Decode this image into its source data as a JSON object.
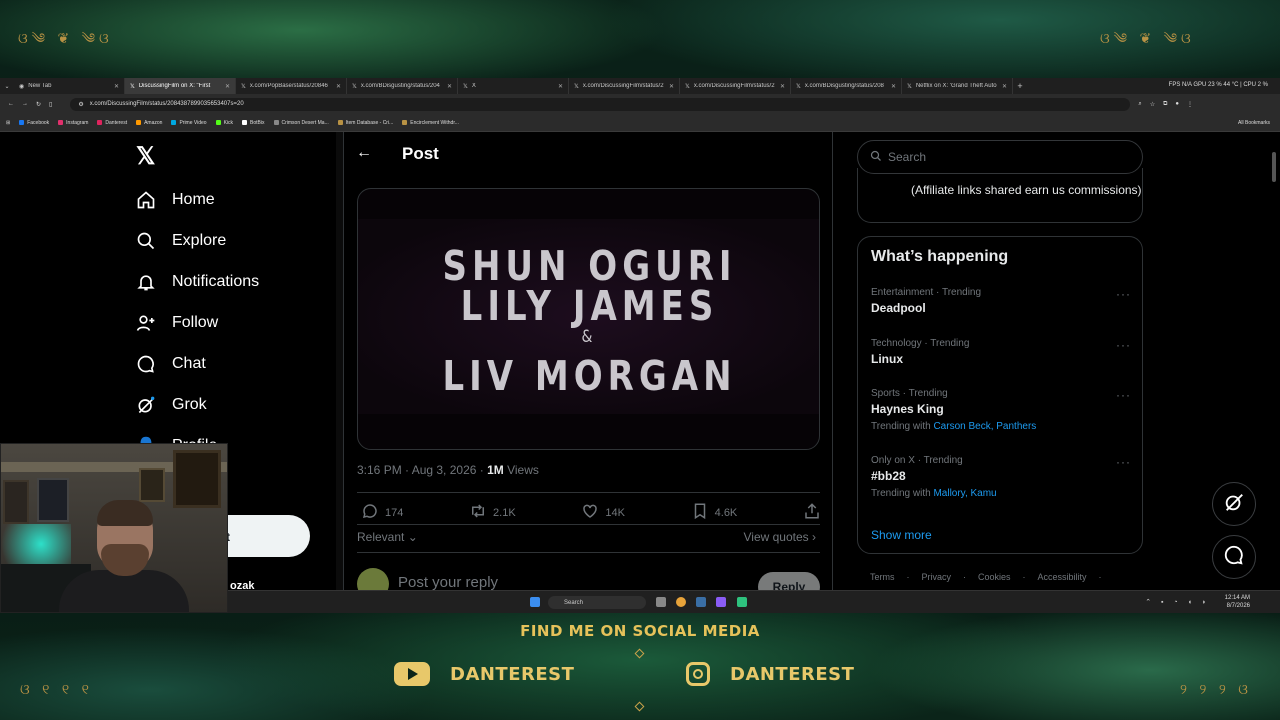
{
  "browser": {
    "tabs": [
      {
        "label": "New Tab",
        "active": false
      },
      {
        "label": "DiscussingFilm on X: \"First",
        "active": true
      },
      {
        "label": "x.com/PopBase/status/20846",
        "active": false
      },
      {
        "label": "x.com/BDisgusting/status/204",
        "active": false
      },
      {
        "label": "X",
        "active": false
      },
      {
        "label": "x.com/DiscussingFilm/status/2",
        "active": false
      },
      {
        "label": "x.com/DiscussingFilm/status/2",
        "active": false
      },
      {
        "label": "x.com/BDisgusting/status/208",
        "active": false
      },
      {
        "label": "Netflix on X: 'Grand Theft Auto",
        "active": false
      }
    ],
    "tab_close": "✕",
    "new_tab": "+",
    "sysinfo": "FPS  N/A   GPU  23 %  44 °C  |  CPU  2 %",
    "url": "x.com/DiscussingFilm/status/2084387899035653407s=20",
    "bookmarks": [
      {
        "label": "Facebook",
        "color": "#1877f2"
      },
      {
        "label": "Instagram",
        "color": "#e1306c"
      },
      {
        "label": "Danterest",
        "color": "#e0245e"
      },
      {
        "label": "Amazon",
        "color": "#ff9900"
      },
      {
        "label": "Prime Video",
        "color": "#00a8e1"
      },
      {
        "label": "Kick",
        "color": "#53fc18"
      },
      {
        "label": "BotBix",
        "color": "#ffffff"
      },
      {
        "label": "Crimson Desert Ma...",
        "color": "#888888"
      },
      {
        "label": "Item Database - Cri...",
        "color": "#b89244"
      },
      {
        "label": "Encirclement Withdr...",
        "color": "#b89244"
      }
    ],
    "all_bookmarks": "All Bookmarks"
  },
  "nav": {
    "logo": "𝕏",
    "items": [
      {
        "label": "Home"
      },
      {
        "label": "Explore"
      },
      {
        "label": "Notifications"
      },
      {
        "label": "Follow"
      },
      {
        "label": "Chat"
      },
      {
        "label": "Grok"
      },
      {
        "label": "Profile"
      }
    ],
    "post_label": "t",
    "user_fragment": "ozak"
  },
  "post": {
    "header": "Post",
    "back": "←",
    "cast_lines": [
      "SHUN OGURI",
      "LILY JAMES",
      "&",
      "LIV MORGAN"
    ],
    "time": "3:16 PM · Aug 3, 2026 · ",
    "views_count": "1M",
    "views_label": " Views",
    "actions": {
      "replies": "174",
      "reposts": "2.1K",
      "likes": "14K",
      "bookmarks": "4.6K"
    },
    "relevant": "Relevant ⌄",
    "view_quotes": "View quotes ›",
    "reply_placeholder": "Post your reply",
    "reply_button": "Reply"
  },
  "right": {
    "search_placeholder": "Search",
    "affiliate_text": "(Affiliate links shared earn us commissions)",
    "trends_title": "What’s happening",
    "trends": [
      {
        "category": "Entertainment · Trending",
        "name": "Deadpool",
        "with_label": "",
        "with_links": ""
      },
      {
        "category": "Technology · Trending",
        "name": "Linux",
        "with_label": "",
        "with_links": ""
      },
      {
        "category": "Sports · Trending",
        "name": "Haynes King",
        "with_label": "Trending with",
        "with_links": "Carson Beck, Panthers"
      },
      {
        "category": "Only on X · Trending",
        "name": "#bb28",
        "with_label": "Trending with",
        "with_links": "Mallory, Kamu"
      }
    ],
    "more": "···",
    "show_more": "Show more",
    "footer": [
      "Terms",
      "·",
      "Privacy",
      "·",
      "Cookies",
      "·",
      "Accessibility",
      "·"
    ]
  },
  "taskbar": {
    "search": "Search",
    "time": "12:14 AM",
    "date": "8/7/2026"
  },
  "overlay": {
    "title": "FIND ME ON SOCIAL MEDIA",
    "youtube": "DANTEREST",
    "instagram": "DANTEREST"
  },
  "colors": {
    "accent": "#1d9bf0",
    "gold": "#e6c25a"
  }
}
